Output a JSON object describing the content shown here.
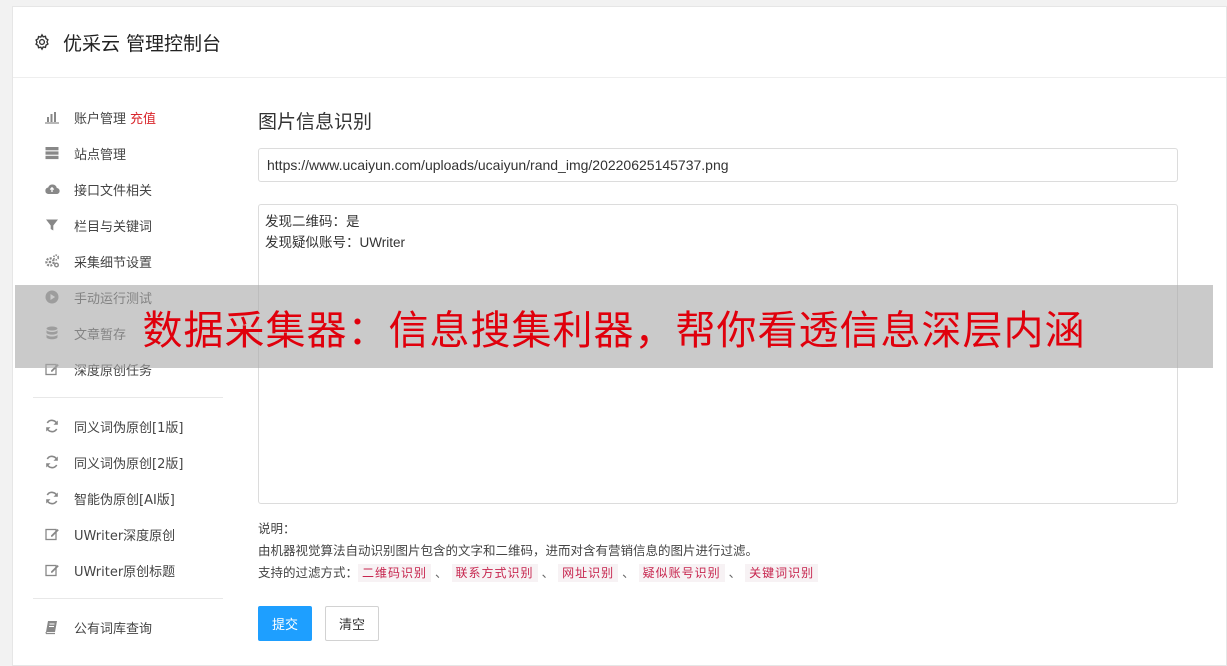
{
  "header": {
    "title": "优采云 管理控制台"
  },
  "sidebar": {
    "group1": [
      {
        "label": "账户管理",
        "extra": "充值",
        "icon": "bar-chart-icon"
      },
      {
        "label": "站点管理",
        "icon": "server-icon"
      },
      {
        "label": "接口文件相关",
        "icon": "cloud-upload-icon"
      },
      {
        "label": "栏目与关键词",
        "icon": "filter-icon"
      },
      {
        "label": "采集细节设置",
        "icon": "cogs-icon"
      },
      {
        "label": "手动运行测试",
        "icon": "play-icon"
      },
      {
        "label": "文章暂存",
        "icon": "database-icon"
      },
      {
        "label": "深度原创任务",
        "icon": "edit-icon"
      }
    ],
    "group2": [
      {
        "label": "同义词伪原创[1版]",
        "icon": "refresh-icon"
      },
      {
        "label": "同义词伪原创[2版]",
        "icon": "refresh-icon"
      },
      {
        "label": "智能伪原创[AI版]",
        "icon": "refresh-icon"
      },
      {
        "label": "UWriter深度原创",
        "icon": "edit-icon"
      },
      {
        "label": "UWriter原创标题",
        "icon": "edit-icon"
      }
    ],
    "group3": [
      {
        "label": "公有词库查询",
        "icon": "book-icon"
      }
    ]
  },
  "main": {
    "title": "图片信息识别",
    "url_value": "https://www.ucaiyun.com/uploads/ucaiyun/rand_img/20220625145737.png",
    "result_lines": [
      "发现二维码：是",
      "发现疑似账号：UWriter"
    ],
    "notes_label": "说明：",
    "notes_desc": "由机器视觉算法自动识别图片包含的文字和二维码，进而对含有营销信息的图片进行过滤。",
    "filters_label": "支持的过滤方式：",
    "filters": [
      "二维码识别",
      "联系方式识别",
      "网址识别",
      "疑似账号识别",
      "关键词识别"
    ],
    "filter_separator": "、",
    "submit_label": "提交",
    "clear_label": "清空"
  },
  "banner": {
    "text": "数据采集器：信息搜集利器，帮你看透信息深层内涵"
  },
  "colors": {
    "accent": "#1e9fff",
    "tag_text": "#c7254e",
    "banner_text": "#e0000c",
    "recharge": "#d9262c"
  }
}
